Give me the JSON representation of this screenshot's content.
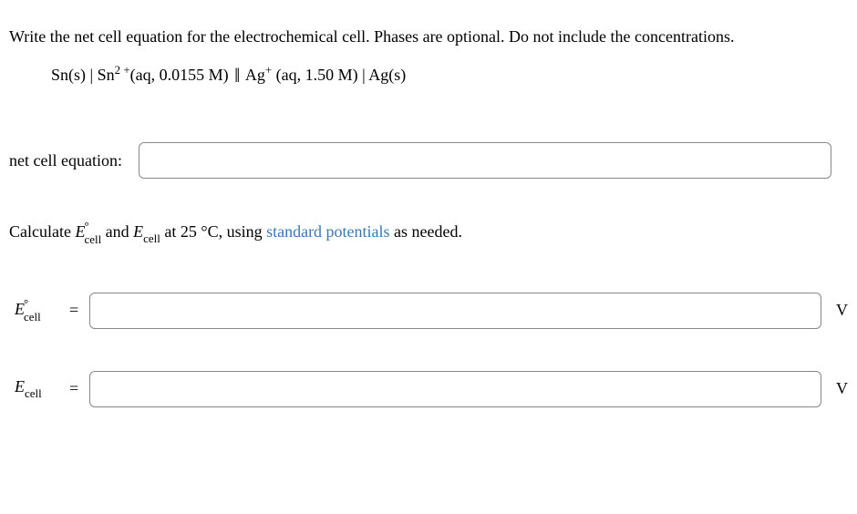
{
  "question": {
    "prompt_text": "Write the net cell equation for the electrochemical cell. Phases are optional. Do not include the concentrations.",
    "calc_prefix": "Calculate ",
    "calc_and": " and ",
    "calc_suffix": " at 25 °C, using ",
    "link_text": "standard potentials",
    "calc_end": " as needed."
  },
  "cell_notation": {
    "sn_s": "Sn(s)",
    "sn2": "Sn",
    "sn2_charge_top": "2 +",
    "sn2_charge_bot": "",
    "aq1": "(aq, 0.0155 M)",
    "ag_plus": "Ag",
    "ag_charge": "+",
    "aq2": "(aq, 1.50 M)",
    "ag_s": "Ag(s)",
    "sep1": "|",
    "sep_double": "||",
    "sep2": "|"
  },
  "labels": {
    "net_cell": "net cell equation:",
    "e_symbol": "E",
    "cell_sub": "cell",
    "circ": "°",
    "equals": "=",
    "unit": "V"
  },
  "inputs": {
    "net_cell_value": "",
    "e_std_value": "",
    "e_cell_value": ""
  }
}
